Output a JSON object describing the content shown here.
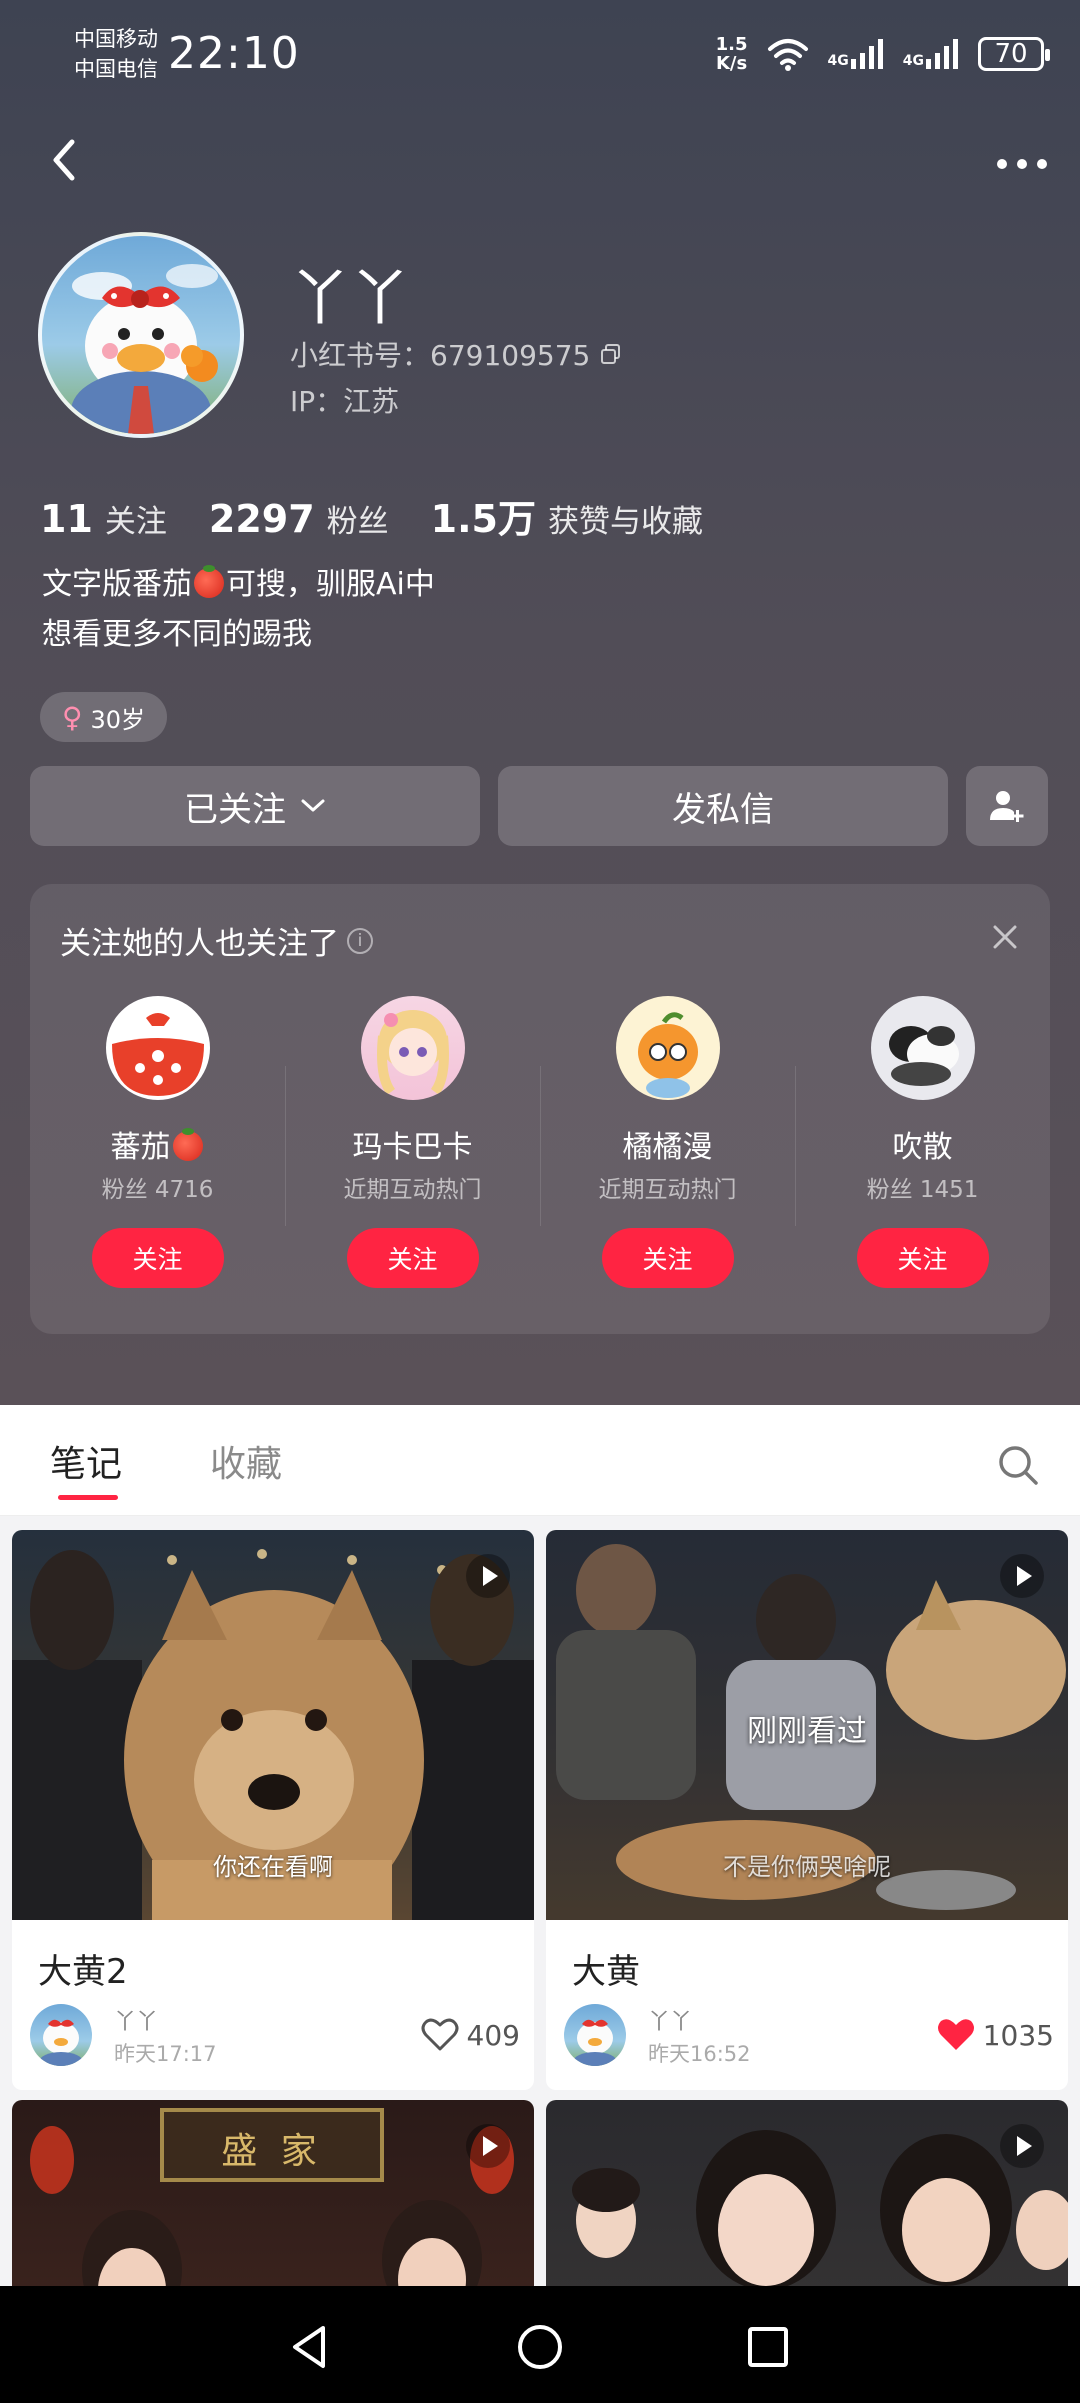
{
  "status_bar": {
    "carrier_1": "中国移动",
    "carrier_2": "中国电信",
    "time": "22:10",
    "net_speed_value": "1.5",
    "net_speed_unit": "K/s",
    "signal_label_1": "4G",
    "signal_label_2": "4G",
    "battery": "70"
  },
  "profile": {
    "nickname": "丫丫",
    "redbook_id": "小红书号：679109575",
    "ip": "IP：江苏",
    "stats": [
      {
        "value": "11",
        "label": "关注"
      },
      {
        "value": "2297",
        "label": "粉丝"
      },
      {
        "value": "1.5万",
        "label": "获赞与收藏"
      }
    ],
    "bio_line1_a": "文字版番茄",
    "bio_line1_b": "可搜，驯服Ai中",
    "bio_line2": "想看更多不同的踢我",
    "age_tag": "30岁"
  },
  "actions": {
    "following_label": "已关注",
    "message_label": "发私信"
  },
  "suggestions": {
    "title": "关注她的人也关注了",
    "items": [
      {
        "name": "蕃茄",
        "sub": "粉丝 4716",
        "follow": "关注"
      },
      {
        "name": "玛卡巴卡",
        "sub": "近期互动热门",
        "follow": "关注"
      },
      {
        "name": "橘橘漫",
        "sub": "近期互动热门",
        "follow": "关注"
      },
      {
        "name": "吹散",
        "sub": "粉丝 1451",
        "follow": "关注"
      }
    ]
  },
  "tabs": {
    "notes": "笔记",
    "collections": "收藏"
  },
  "notes": [
    {
      "title": "大黄2",
      "caption": "你还在看啊",
      "author": "丫丫",
      "time": "昨天17:17",
      "likes": "409",
      "liked": false
    },
    {
      "title": "大黄",
      "caption": "不是你俩哭啥呢",
      "overlay": "刚刚看过",
      "author": "丫丫",
      "time": "昨天16:52",
      "likes": "1035",
      "liked": true
    },
    {
      "title": "",
      "sign_text": "盛 家"
    },
    {
      "title": ""
    }
  ],
  "colors": {
    "accent": "#ff2442",
    "header_bg": "#4a4a55"
  }
}
